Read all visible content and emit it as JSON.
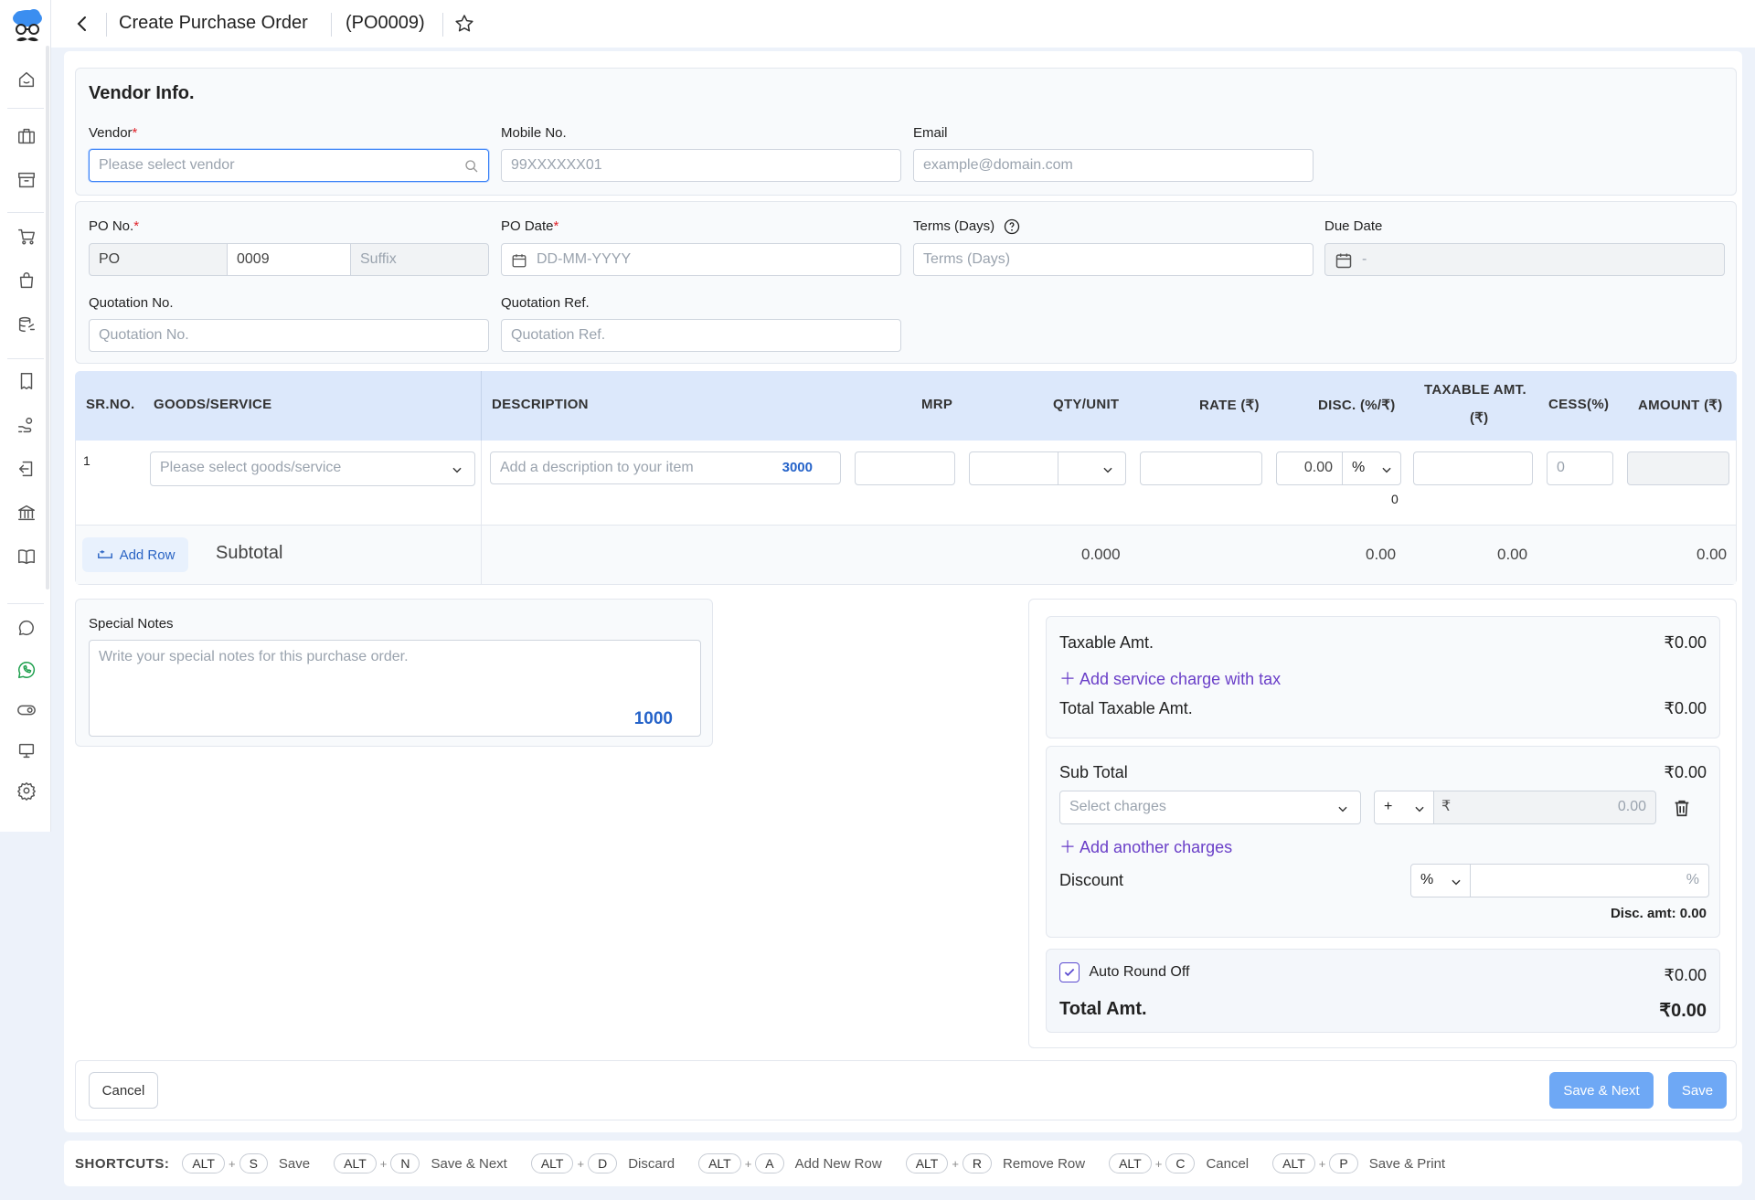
{
  "header": {
    "title": "Create Purchase Order",
    "po_code": "(PO0009)"
  },
  "vendor_info": {
    "heading": "Vendor Info.",
    "vendor_label": "Vendor",
    "vendor_placeholder": "Please select vendor",
    "mobile_label": "Mobile No.",
    "mobile_placeholder": "99XXXXXX01",
    "email_label": "Email",
    "email_placeholder": "example@domain.com"
  },
  "po_details": {
    "po_no_label": "PO No.",
    "po_prefix": "PO",
    "po_number": "0009",
    "po_suffix_placeholder": "Suffix",
    "po_date_label": "PO Date",
    "po_date_placeholder": "DD-MM-YYYY",
    "terms_label": "Terms (Days)",
    "terms_placeholder": "Terms (Days)",
    "due_date_label": "Due Date",
    "due_date_value": "-",
    "quotation_no_label": "Quotation No.",
    "quotation_no_placeholder": "Quotation No.",
    "quotation_ref_label": "Quotation Ref.",
    "quotation_ref_placeholder": "Quotation Ref."
  },
  "items_table": {
    "columns": [
      "SR.NO.",
      "GOODS/SERVICE",
      "DESCRIPTION",
      "MRP",
      "QTY/UNIT",
      "RATE (₹)",
      "DISC. (%/₹)",
      "TAXABLE AMT.",
      "(₹)",
      "CESS(%)",
      "AMOUNT (₹)"
    ],
    "row": {
      "sr_no": "1",
      "goods_placeholder": "Please select goods/service",
      "description_placeholder": "Add a description to your item",
      "description_limit": "3000",
      "disc_value": "0.00",
      "disc_type": "%",
      "disc_amount": "0",
      "cess_placeholder": "0"
    },
    "add_row_label": "Add Row",
    "subtotal_label": "Subtotal",
    "subtotal_qty": "0.000",
    "subtotal_disc": "0.00",
    "subtotal_taxable": "0.00",
    "subtotal_amount": "0.00"
  },
  "notes": {
    "label": "Special Notes",
    "placeholder": "Write your special notes for this purchase order.",
    "limit": "1000"
  },
  "summary": {
    "taxable_label": "Taxable Amt.",
    "taxable_value": "₹0.00",
    "add_service_charge": "Add service charge with tax",
    "total_taxable_label": "Total Taxable Amt.",
    "total_taxable_value": "₹0.00",
    "sub_total_label": "Sub Total",
    "sub_total_value": "₹0.00",
    "charges_placeholder": "Select charges",
    "charge_sign": "+",
    "currency_symbol": "₹",
    "charge_value": "0.00",
    "add_another_charges": "Add another charges",
    "discount_label": "Discount",
    "discount_type": "%",
    "discount_suffix": "%",
    "disc_amt_text": "Disc. amt: 0.00",
    "auto_round_off_label": "Auto Round Off",
    "auto_round_off_checked": true,
    "round_off_value": "₹0.00",
    "total_label": "Total Amt.",
    "total_value": "₹0.00"
  },
  "footer": {
    "cancel": "Cancel",
    "save_next": "Save & Next",
    "save": "Save"
  },
  "shortcuts": {
    "label": "SHORTCUTS:",
    "items": [
      {
        "mod": "ALT",
        "key": "S",
        "action": "Save"
      },
      {
        "mod": "ALT",
        "key": "N",
        "action": "Save & Next"
      },
      {
        "mod": "ALT",
        "key": "D",
        "action": "Discard"
      },
      {
        "mod": "ALT",
        "key": "A",
        "action": "Add New Row"
      },
      {
        "mod": "ALT",
        "key": "R",
        "action": "Remove Row"
      },
      {
        "mod": "ALT",
        "key": "C",
        "action": "Cancel"
      },
      {
        "mod": "ALT",
        "key": "P",
        "action": "Save & Print"
      }
    ]
  },
  "colors": {
    "accent": "#6a3fc8",
    "primary_button": "#6ea8f5",
    "table_header": "#dce8fb",
    "limit_text": "#2563c9"
  }
}
